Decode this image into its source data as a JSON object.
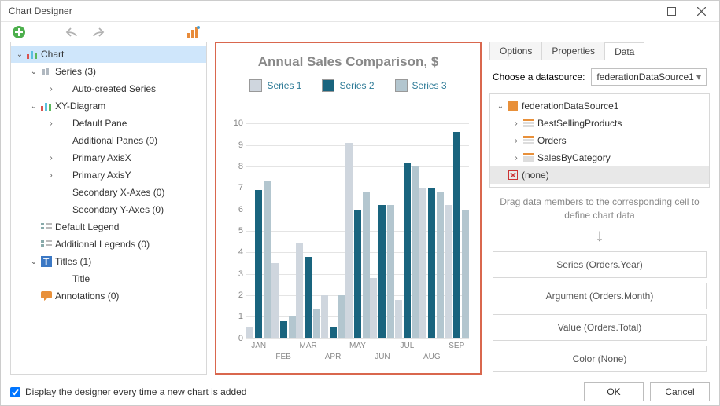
{
  "window": {
    "title": "Chart Designer"
  },
  "toolbar": {
    "add": "add",
    "undo": "undo",
    "redo": "redo",
    "wizard": "wizard"
  },
  "tree": {
    "root": "Chart",
    "series": "Series (3)",
    "auto": "Auto-created Series",
    "xy": "XY-Diagram",
    "pane": "Default Pane",
    "addpanes": "Additional Panes (0)",
    "ax": "Primary AxisX",
    "ay": "Primary AxisY",
    "sax": "Secondary X-Axes (0)",
    "say": "Secondary Y-Axes (0)",
    "legend": "Default Legend",
    "legends": "Additional Legends (0)",
    "titles": "Titles (1)",
    "title": "Title",
    "annot": "Annotations (0)"
  },
  "tabs": {
    "options": "Options",
    "properties": "Properties",
    "data": "Data"
  },
  "datasource": {
    "label": "Choose a datasource:",
    "value": "federationDataSource1",
    "root": "federationDataSource1",
    "items": [
      "BestSellingProducts",
      "Orders",
      "SalesByCategory"
    ],
    "none": "(none)"
  },
  "hint": "Drag data members to the corresponding cell to define chart data",
  "bindings": {
    "series": "Series (Orders.Year)",
    "argument": "Argument (Orders.Month)",
    "value": "Value (Orders.Total)",
    "color": "Color (None)"
  },
  "footer": {
    "checkbox": "Display the designer every time a new chart is added",
    "ok": "OK",
    "cancel": "Cancel"
  },
  "chart_data": {
    "type": "bar",
    "title": "Annual Sales Comparison, $",
    "categories": [
      "JAN",
      "FEB",
      "MAR",
      "APR",
      "MAY",
      "JUN",
      "JUL",
      "AUG",
      "SEP"
    ],
    "ylim": [
      0,
      10
    ],
    "series": [
      {
        "name": "Series 1",
        "color": "#cfd6de",
        "values": [
          0.5,
          3.5,
          4.4,
          2.0,
          9.1,
          2.8,
          1.8,
          7.0,
          6.2
        ]
      },
      {
        "name": "Series 2",
        "color": "#19647e",
        "values": [
          6.9,
          0.8,
          3.8,
          0.5,
          6.0,
          6.2,
          8.2,
          7.0,
          9.6
        ]
      },
      {
        "name": "Series 3",
        "color": "#b3c6cf",
        "values": [
          7.3,
          1.0,
          1.4,
          2.0,
          6.8,
          6.2,
          8.0,
          6.8,
          6.0
        ]
      }
    ]
  }
}
